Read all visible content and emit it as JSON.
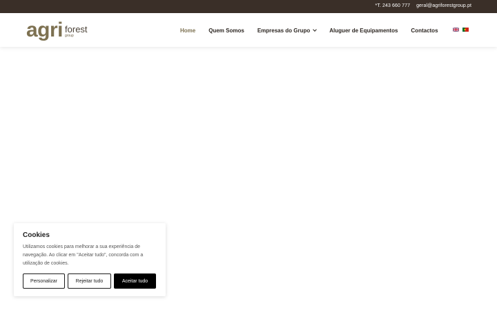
{
  "topbar": {
    "phone": "*T. 243 660 777",
    "email": "geral@agriforestgroup.pt"
  },
  "logo": {
    "agri": "agri",
    "forest": "forest",
    "group": "group"
  },
  "nav": {
    "items": [
      {
        "label": "Home",
        "active": true
      },
      {
        "label": "Quem Somos"
      },
      {
        "label": "Empresas do Grupo",
        "has_dropdown": true
      },
      {
        "label": "Aluguer de Equipamentos"
      },
      {
        "label": "Contactos"
      }
    ],
    "languages": [
      "en-flag-icon",
      "pt-flag-icon"
    ]
  },
  "cookie_banner": {
    "title": "Cookies",
    "text": "Utilizamos cookies para melhorar a sua experiência de navegação. Ao clicar em \"Aceitar tudo\", concorda com a utilização de cookies.",
    "buttons": {
      "customize": "Personalizar",
      "reject": "Rejeitar tudo",
      "accept": "Aceitar tudo"
    }
  },
  "colors": {
    "topbar_bg": "#3a2f28",
    "accent": "#7d7151",
    "accept_bg": "#000000"
  }
}
